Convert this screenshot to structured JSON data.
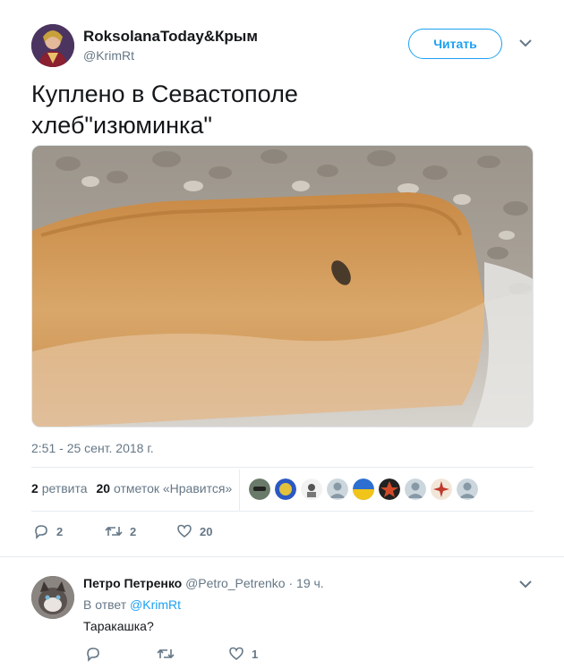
{
  "tweet": {
    "display_name": "RoksolanaToday&Крым",
    "handle": "@KrimRt",
    "follow_label": "Читать",
    "text_lines": [
      "Куплено в Севастополе",
      "хлеб\"изюминка\""
    ],
    "timestamp": "2:51 - 25 сент. 2018 г.",
    "retweets_count": "2",
    "retweets_label": "ретвита",
    "likes_count": "20",
    "likes_label": "отметок «Нравится»",
    "actions": {
      "reply_count": "2",
      "retweet_count": "2",
      "like_count": "20"
    }
  },
  "reply": {
    "display_name": "Петро Петренко",
    "meta": "@Petro_Petrenko · 19 ч.",
    "in_reply_prefix": "В ответ",
    "in_reply_handle": "@KrimRt",
    "text": "Таракашка?",
    "actions": {
      "reply_count": "",
      "retweet_count": "",
      "like_count": "1"
    }
  },
  "colors": {
    "accent": "#1da1f2",
    "muted": "#657786",
    "text": "#14171a",
    "divider": "#e6ecf0"
  },
  "icons": [
    "reply-icon",
    "retweet-icon",
    "like-icon",
    "caret-down-icon"
  ]
}
